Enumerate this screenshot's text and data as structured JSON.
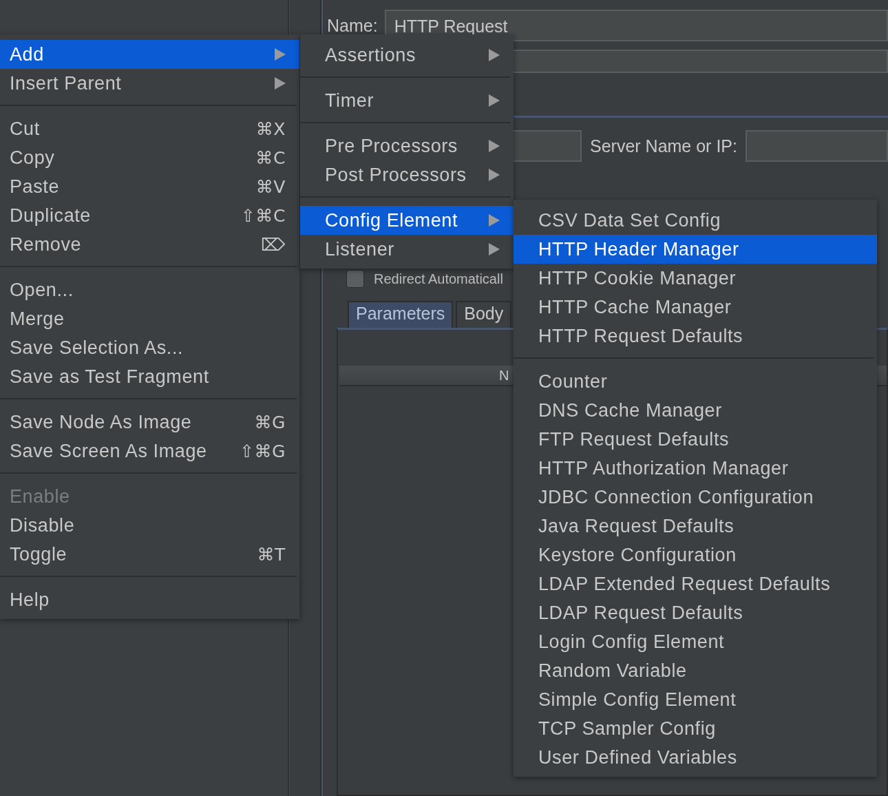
{
  "form": {
    "name_label": "Name:",
    "name_value": "HTTP Request",
    "server_label": "Server Name or IP:",
    "redirect": {
      "label": "Redirect Automaticall",
      "checked": false
    },
    "tabs": [
      {
        "label": "Parameters",
        "selected": true
      },
      {
        "label": "Body",
        "selected": false
      }
    ],
    "table": {
      "columns": [
        "N"
      ]
    }
  },
  "context_menu": {
    "groups": [
      [
        {
          "label": "Add",
          "submenu": true,
          "selected": true,
          "disabled": false
        },
        {
          "label": "Insert Parent",
          "submenu": true,
          "selected": false,
          "disabled": false
        }
      ],
      [
        {
          "label": "Cut",
          "shortcut": "⌘X",
          "selected": false,
          "disabled": false
        },
        {
          "label": "Copy",
          "shortcut": "⌘C",
          "selected": false,
          "disabled": false
        },
        {
          "label": "Paste",
          "shortcut": "⌘V",
          "selected": false,
          "disabled": false
        },
        {
          "label": "Duplicate",
          "shortcut": "⇧⌘C",
          "selected": false,
          "disabled": false
        },
        {
          "label": "Remove",
          "shortcut": "⌦",
          "selected": false,
          "disabled": false
        }
      ],
      [
        {
          "label": "Open...",
          "selected": false,
          "disabled": false
        },
        {
          "label": "Merge",
          "selected": false,
          "disabled": false
        },
        {
          "label": "Save Selection As...",
          "selected": false,
          "disabled": false
        },
        {
          "label": "Save as Test Fragment",
          "selected": false,
          "disabled": false
        }
      ],
      [
        {
          "label": "Save Node As Image",
          "shortcut": "⌘G",
          "selected": false,
          "disabled": false
        },
        {
          "label": "Save Screen As Image",
          "shortcut": "⇧⌘G",
          "selected": false,
          "disabled": false
        }
      ],
      [
        {
          "label": "Enable",
          "selected": false,
          "disabled": true
        },
        {
          "label": "Disable",
          "selected": false,
          "disabled": false
        },
        {
          "label": "Toggle",
          "shortcut": "⌘T",
          "selected": false,
          "disabled": false
        }
      ],
      [
        {
          "label": "Help",
          "selected": false,
          "disabled": false
        }
      ]
    ]
  },
  "add_submenu": {
    "groups": [
      [
        {
          "label": "Assertions",
          "submenu": true,
          "selected": false
        }
      ],
      [
        {
          "label": "Timer",
          "submenu": true,
          "selected": false
        }
      ],
      [
        {
          "label": "Pre Processors",
          "submenu": true,
          "selected": false
        },
        {
          "label": "Post Processors",
          "submenu": true,
          "selected": false
        }
      ],
      [
        {
          "label": "Config Element",
          "submenu": true,
          "selected": true
        },
        {
          "label": "Listener",
          "submenu": true,
          "selected": false
        }
      ]
    ]
  },
  "config_submenu": {
    "groups": [
      [
        {
          "label": "CSV Data Set Config",
          "selected": false
        },
        {
          "label": "HTTP Header Manager",
          "selected": true
        },
        {
          "label": "HTTP Cookie Manager",
          "selected": false
        },
        {
          "label": "HTTP Cache Manager",
          "selected": false
        },
        {
          "label": "HTTP Request Defaults",
          "selected": false
        }
      ],
      [
        {
          "label": "Counter",
          "selected": false
        },
        {
          "label": "DNS Cache Manager",
          "selected": false
        },
        {
          "label": "FTP Request Defaults",
          "selected": false
        },
        {
          "label": "HTTP Authorization Manager",
          "selected": false
        },
        {
          "label": "JDBC Connection Configuration",
          "selected": false
        },
        {
          "label": "Java Request Defaults",
          "selected": false
        },
        {
          "label": "Keystore Configuration",
          "selected": false
        },
        {
          "label": "LDAP Extended Request Defaults",
          "selected": false
        },
        {
          "label": "LDAP Request Defaults",
          "selected": false
        },
        {
          "label": "Login Config Element",
          "selected": false
        },
        {
          "label": "Random Variable",
          "selected": false
        },
        {
          "label": "Simple Config Element",
          "selected": false
        },
        {
          "label": "TCP Sampler Config",
          "selected": false
        },
        {
          "label": "User Defined Variables",
          "selected": false
        }
      ]
    ]
  }
}
